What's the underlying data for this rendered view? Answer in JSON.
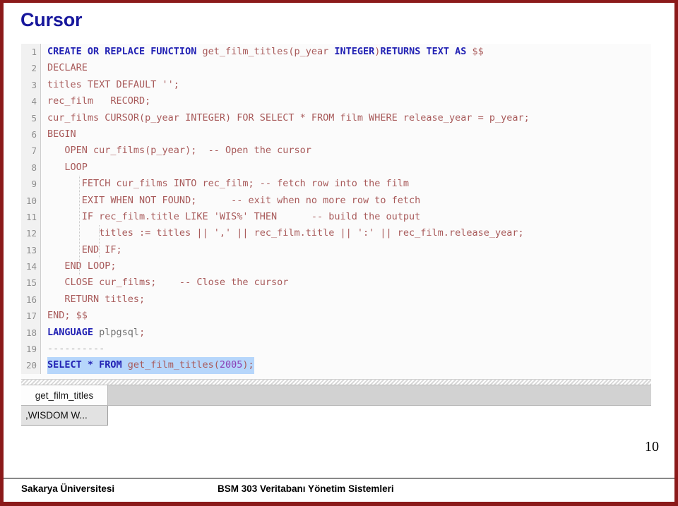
{
  "slide": {
    "title": "Cursor",
    "page_number": "10",
    "border_color": "#8b1a1a",
    "title_color": "#17179c"
  },
  "editor": {
    "selection_color": "#b6d6fb",
    "keyword_color": "#2222b4",
    "text_color": "#a85a5a",
    "comment_color": "#a8a8a8",
    "gutter_background": "#f1f1f1",
    "lines": [
      {
        "number": "1",
        "selected": false,
        "tokens": [
          {
            "t": "CREATE OR REPLACE FUNCTION ",
            "c": "kw"
          },
          {
            "t": "get_film_titles(p_year ",
            "c": "ident"
          },
          {
            "t": "INTEGER",
            "c": "kw"
          },
          {
            "t": ")",
            "c": "ident"
          },
          {
            "t": "RETURNS TEXT AS ",
            "c": "kw"
          },
          {
            "t": "$$",
            "c": "ident"
          }
        ]
      },
      {
        "number": "2",
        "selected": false,
        "tokens": [
          {
            "t": "DECLARE",
            "c": "ident"
          }
        ]
      },
      {
        "number": "3",
        "selected": false,
        "tokens": [
          {
            "t": "titles TEXT DEFAULT '';",
            "c": "ident"
          }
        ]
      },
      {
        "number": "4",
        "selected": false,
        "tokens": [
          {
            "t": "rec_film   RECORD;",
            "c": "ident"
          }
        ]
      },
      {
        "number": "5",
        "selected": false,
        "tokens": [
          {
            "t": "cur_films CURSOR(p_year INTEGER) FOR SELECT * FROM film WHERE release_year = p_year;",
            "c": "ident"
          }
        ]
      },
      {
        "number": "6",
        "selected": false,
        "tokens": [
          {
            "t": "BEGIN",
            "c": "ident"
          }
        ]
      },
      {
        "number": "7",
        "selected": false,
        "tokens": [
          {
            "t": "   OPEN cur_films(p_year);  ",
            "c": "ident"
          },
          {
            "t": "-- Open the cursor",
            "c": "ident"
          }
        ]
      },
      {
        "number": "8",
        "selected": false,
        "tokens": [
          {
            "t": "   LOOP",
            "c": "ident"
          }
        ]
      },
      {
        "number": "9",
        "selected": false,
        "tokens": [
          {
            "t": "      FETCH cur_films INTO rec_film; -- fetch row into the film",
            "c": "ident"
          }
        ]
      },
      {
        "number": "10",
        "selected": false,
        "tokens": [
          {
            "t": "      EXIT WHEN NOT FOUND;      -- exit when no more row to fetch",
            "c": "ident"
          }
        ]
      },
      {
        "number": "11",
        "selected": false,
        "tokens": [
          {
            "t": "      IF rec_film.title LIKE 'WIS%' THEN      -- build the output",
            "c": "ident"
          }
        ]
      },
      {
        "number": "12",
        "selected": false,
        "tokens": [
          {
            "t": "         titles := titles || ',' || rec_film.title || ':' || rec_film.release_year;",
            "c": "ident"
          }
        ]
      },
      {
        "number": "13",
        "selected": false,
        "tokens": [
          {
            "t": "      END IF;",
            "c": "ident"
          }
        ]
      },
      {
        "number": "14",
        "selected": false,
        "tokens": [
          {
            "t": "   END LOOP;",
            "c": "ident"
          }
        ]
      },
      {
        "number": "15",
        "selected": false,
        "tokens": [
          {
            "t": "   CLOSE cur_films;    -- Close the cursor",
            "c": "ident"
          }
        ]
      },
      {
        "number": "16",
        "selected": false,
        "tokens": [
          {
            "t": "   RETURN titles;",
            "c": "ident"
          }
        ]
      },
      {
        "number": "17",
        "selected": false,
        "tokens": [
          {
            "t": "END; $$",
            "c": "ident"
          }
        ]
      },
      {
        "number": "18",
        "selected": false,
        "tokens": [
          {
            "t": "LANGUAGE ",
            "c": "kw"
          },
          {
            "t": "plpgsql",
            "c": "plain"
          },
          {
            "t": ";",
            "c": "ident"
          }
        ]
      },
      {
        "number": "19",
        "selected": false,
        "tokens": [
          {
            "t": "----------",
            "c": "cmt"
          }
        ]
      },
      {
        "number": "20",
        "selected": true,
        "tokens": [
          {
            "t": "SELECT * FROM ",
            "c": "kw"
          },
          {
            "t": "get_film_titles(",
            "c": "ident"
          },
          {
            "t": "2005",
            "c": "num"
          },
          {
            "t": ");",
            "c": "ident"
          }
        ]
      }
    ]
  },
  "results": {
    "column_header": "get_film_titles",
    "cell_value": ",WISDOM W..."
  },
  "footer": {
    "left": "Sakarya Üniversitesi",
    "center": "BSM 303 Veritabanı Yönetim Sistemleri"
  }
}
